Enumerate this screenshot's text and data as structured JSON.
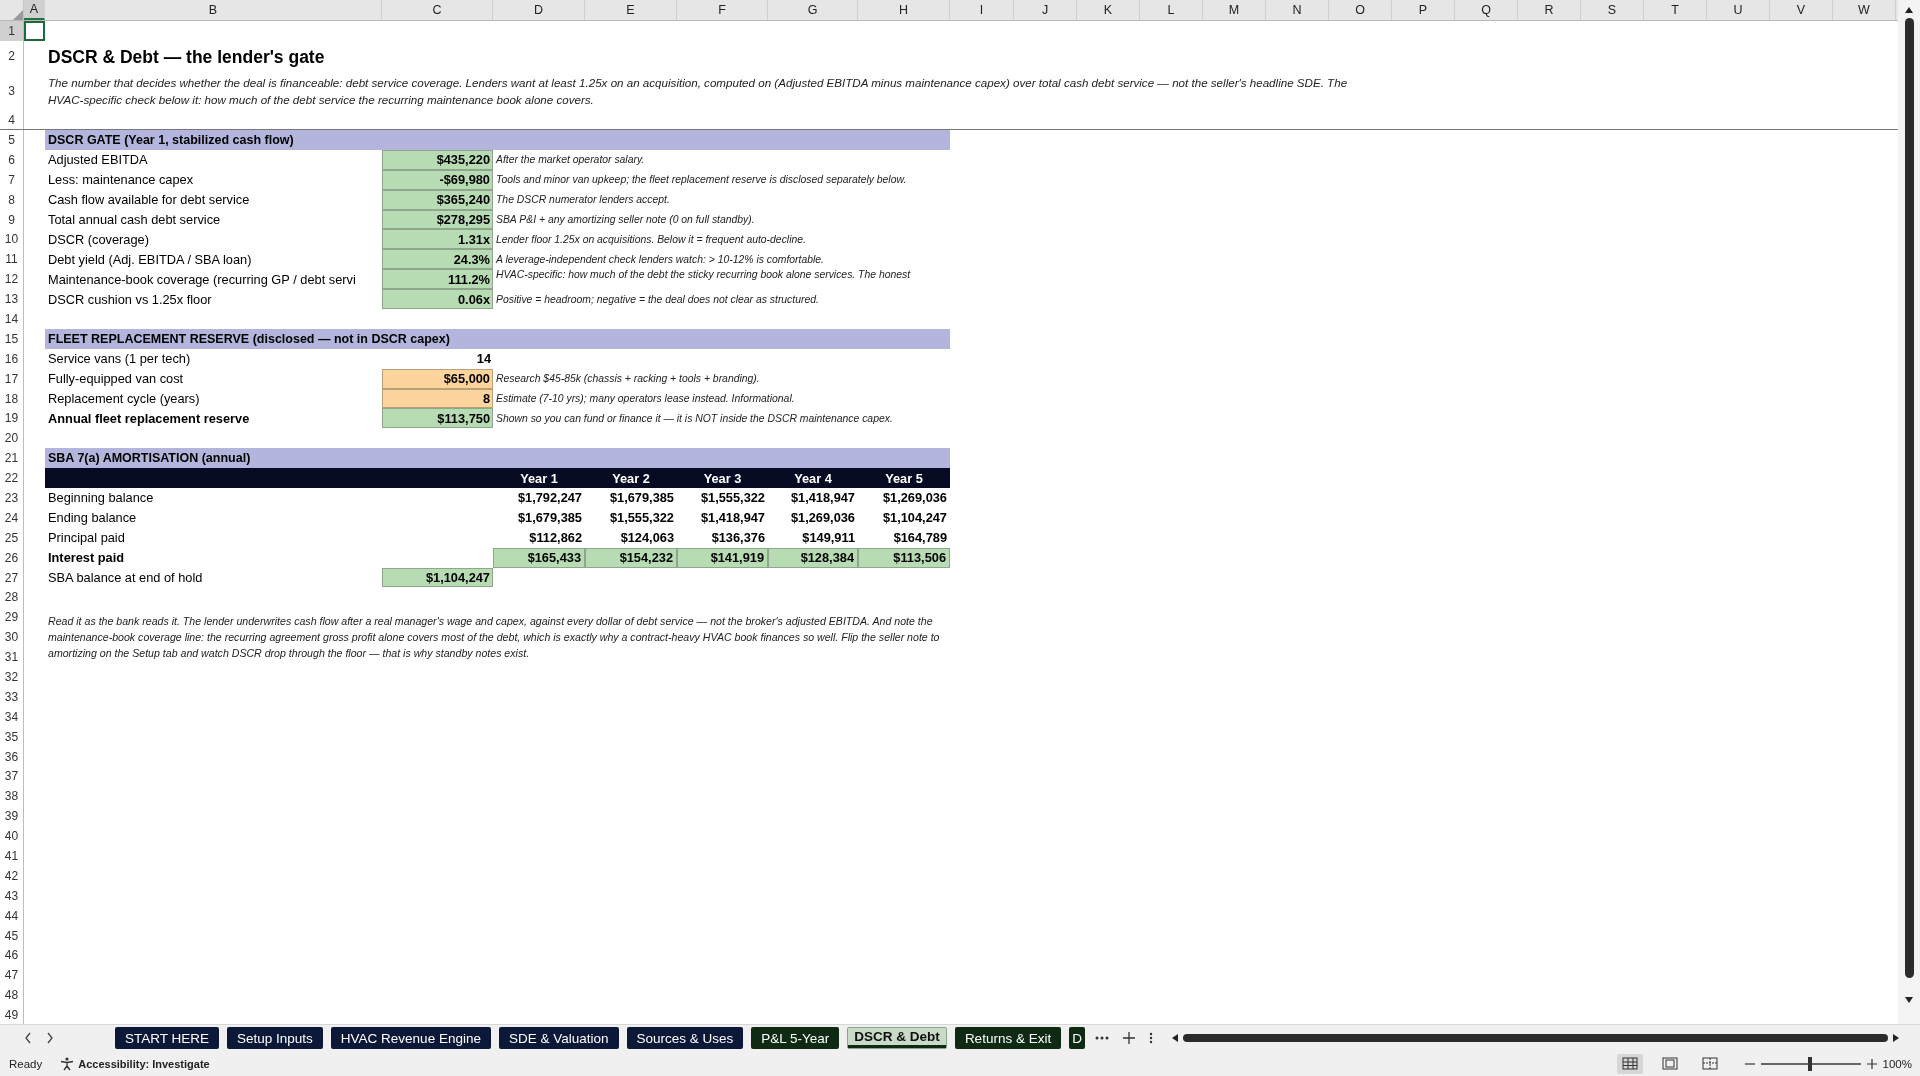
{
  "column_headers": [
    "A",
    "B",
    "C",
    "D",
    "E",
    "F",
    "G",
    "H",
    "I",
    "J",
    "K",
    "L",
    "M",
    "N",
    "O",
    "P",
    "Q",
    "R",
    "S",
    "T",
    "U",
    "V",
    "W"
  ],
  "row_numbers": [
    "1",
    "2",
    "3",
    "4",
    "5",
    "6",
    "7",
    "8",
    "9",
    "10",
    "11",
    "12",
    "13",
    "14",
    "15",
    "16",
    "17",
    "18",
    "19",
    "20",
    "21",
    "22",
    "23",
    "24",
    "25",
    "26",
    "27",
    "28",
    "29",
    "30",
    "31",
    "32",
    "33",
    "34",
    "35",
    "36",
    "37",
    "38",
    "39",
    "40",
    "41",
    "42",
    "43",
    "44",
    "45",
    "46",
    "47",
    "48",
    "49"
  ],
  "title": "DSCR & Debt — the lender's gate",
  "description": "The number that decides whether the deal is financeable: debt service coverage. Lenders want at least 1.25x on an acquisition, computed on (Adjusted EBITDA minus maintenance capex) over total cash debt service — not the seller's headline SDE. The HVAC-specific check below it: how much of the debt service the recurring maintenance book alone covers.",
  "dscr_gate": {
    "header": "DSCR GATE (Year 1, stabilized cash flow)",
    "rows": [
      {
        "label": "Adjusted EBITDA",
        "value": "$435,220",
        "note": "After the market operator salary.",
        "kind": "calc",
        "bold": false
      },
      {
        "label": "Less: maintenance capex",
        "value": "-$69,980",
        "note": "Tools and minor van upkeep; the fleet replacement reserve is disclosed separately below.",
        "kind": "calc",
        "bold": false
      },
      {
        "label": "Cash flow available for debt service",
        "value": "$365,240",
        "note": "The DSCR numerator lenders accept.",
        "kind": "calc",
        "bold": false
      },
      {
        "label": "Total annual cash debt service",
        "value": "$278,295",
        "note": "SBA P&I + any amortizing seller note (0 on full standby).",
        "kind": "calc",
        "bold": false
      },
      {
        "label": "DSCR (coverage)",
        "value": "1.31x",
        "note": "Lender floor 1.25x on acquisitions. Below it = frequent auto-decline.",
        "kind": "calc",
        "bold": false
      },
      {
        "label": "Debt yield (Adj. EBITDA / SBA loan)",
        "value": "24.3%",
        "note": "A leverage-independent check lenders watch: > 10-12% is comfortable.",
        "kind": "calc",
        "bold": false
      },
      {
        "label": "Maintenance-book coverage (recurring GP / debt servi",
        "value": "111.2%",
        "note": "HVAC-specific: how much of the debt the sticky recurring book alone services. The honest",
        "kind": "calc",
        "bold": false
      },
      {
        "label": "DSCR cushion vs 1.25x floor",
        "value": "0.06x",
        "note": "Positive = headroom; negative = the deal does not clear as structured.",
        "kind": "calc",
        "bold": false
      }
    ]
  },
  "fleet_reserve": {
    "header": "FLEET REPLACEMENT RESERVE (disclosed — not in DSCR capex)",
    "rows": [
      {
        "label": "Service vans (1 per tech)",
        "value": "14",
        "kind": "plain",
        "bold": false
      },
      {
        "label": "Fully-equipped van cost",
        "value": "$65,000",
        "note": "Research $45-85k (chassis + racking + tools + branding).",
        "kind": "input",
        "bold": false
      },
      {
        "label": "Replacement cycle (years)",
        "value": "8",
        "note": "Estimate (7-10 yrs); many operators lease instead. Informational.",
        "kind": "input",
        "bold": false
      },
      {
        "label": "Annual fleet replacement reserve",
        "value": "$113,750",
        "note": "Shown so you can fund or finance it — it is NOT inside the DSCR maintenance capex.",
        "kind": "calc",
        "bold": true
      }
    ]
  },
  "amortisation": {
    "header": "SBA 7(a) AMORTISATION (annual)",
    "columns": [
      "Year 1",
      "Year 2",
      "Year 3",
      "Year 4",
      "Year 5"
    ],
    "rows": [
      {
        "label": "Beginning balance",
        "values": [
          "$1,792,247",
          "$1,679,385",
          "$1,555,322",
          "$1,418,947",
          "$1,269,036"
        ],
        "kind": "plain",
        "bold": false
      },
      {
        "label": "Ending balance",
        "values": [
          "$1,679,385",
          "$1,555,322",
          "$1,418,947",
          "$1,269,036",
          "$1,104,247"
        ],
        "kind": "plain",
        "bold": false
      },
      {
        "label": "Principal paid",
        "values": [
          "$112,862",
          "$124,063",
          "$136,376",
          "$149,911",
          "$164,789"
        ],
        "kind": "plain",
        "bold": false
      },
      {
        "label": "Interest paid",
        "values": [
          "$165,433",
          "$154,232",
          "$141,919",
          "$128,384",
          "$113,506"
        ],
        "kind": "calc",
        "bold": true
      }
    ],
    "end_of_hold": {
      "label": "SBA balance at end of hold",
      "value": "$1,104,247"
    }
  },
  "closing_note": "Read it as the bank reads it. The lender underwrites cash flow after a real manager's wage and capex, against every dollar of debt service — not the broker's adjusted EBITDA. And note the maintenance-book coverage line: the recurring agreement gross profit alone covers most of the debt, which is exactly why a contract-heavy HVAC book finances so well. Flip the seller note to amortizing on the Setup tab and watch DSCR drop through the floor — that is why standby notes exist.",
  "sheet_tabs": [
    {
      "label": "START HERE",
      "selected": false,
      "color": "#0c1838"
    },
    {
      "label": "Setup Inputs",
      "selected": false,
      "color": "#0c1838"
    },
    {
      "label": "HVAC Revenue Engine",
      "selected": false,
      "color": "#0c1838"
    },
    {
      "label": "SDE & Valuation",
      "selected": false,
      "color": "#0c1838"
    },
    {
      "label": "Sources & Uses",
      "selected": false,
      "color": "#0c1838"
    },
    {
      "label": "P&L 5-Year",
      "selected": false,
      "color": "#0e2a12"
    },
    {
      "label": "DSCR & Debt",
      "selected": true,
      "color": "#0e2a12"
    },
    {
      "label": "Returns & Exit",
      "selected": false,
      "color": "#0e2a12"
    },
    {
      "label": "D",
      "selected": false,
      "color": "#0e2a12"
    }
  ],
  "status": {
    "ready": "Ready",
    "accessibility": "Accessibility: Investigate"
  },
  "views": [
    {
      "kind": "normal",
      "selected": true
    },
    {
      "kind": "page_layout",
      "selected": false
    },
    {
      "kind": "page_break",
      "selected": false
    }
  ],
  "zoom": {
    "label": "100%",
    "level": 0.49
  }
}
